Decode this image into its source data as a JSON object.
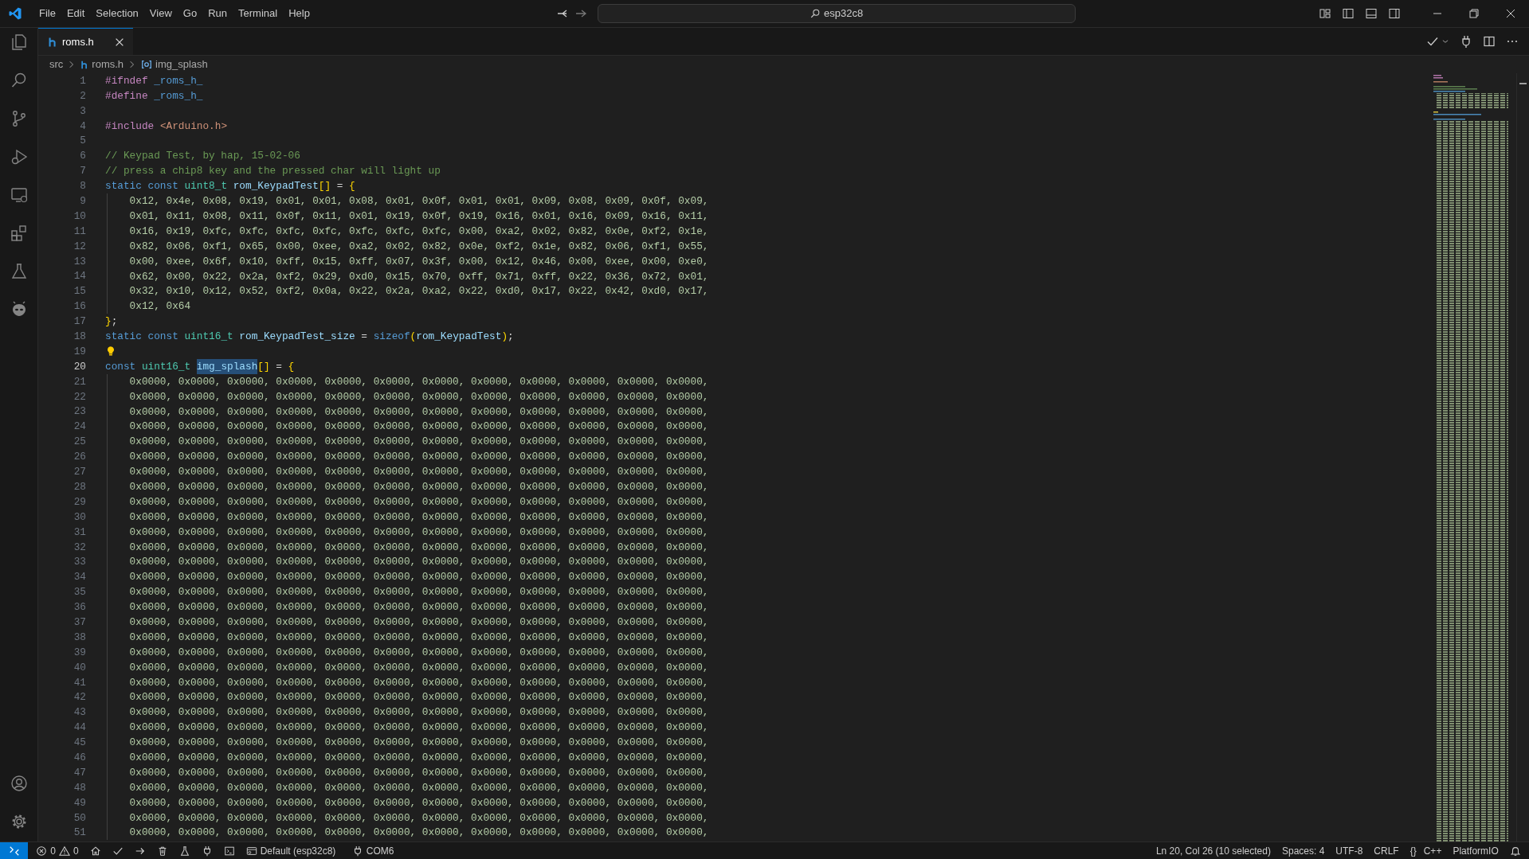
{
  "title_bar": {
    "menu": [
      "File",
      "Edit",
      "Selection",
      "View",
      "Go",
      "Run",
      "Terminal",
      "Help"
    ],
    "search": {
      "value": "esp32c8"
    }
  },
  "tabs": [
    {
      "label": "roms.h",
      "selected": true
    }
  ],
  "breadcrumb": {
    "folder": "src",
    "file": "roms.h",
    "symbol": "img_splash"
  },
  "editor": {
    "lines": [
      {
        "number": "1",
        "current": false,
        "guide": false,
        "tokens": [
          {
            "kind": "pre",
            "text": "#ifndef "
          },
          {
            "kind": "macro",
            "text": "_roms_h_"
          }
        ]
      },
      {
        "number": "2",
        "current": false,
        "guide": false,
        "tokens": [
          {
            "kind": "pre",
            "text": "#define "
          },
          {
            "kind": "macro",
            "text": "_roms_h_"
          }
        ]
      },
      {
        "number": "3",
        "current": false,
        "guide": false
      },
      {
        "number": "4",
        "current": false,
        "guide": false,
        "tokens": [
          {
            "kind": "pre",
            "text": "#include "
          },
          {
            "kind": "str",
            "text": "<Arduino.h>"
          }
        ]
      },
      {
        "number": "5",
        "current": false,
        "guide": false
      },
      {
        "number": "6",
        "current": false,
        "guide": false,
        "tokens": [
          {
            "kind": "com",
            "text": "// Keypad Test, by hap, 15-02-06"
          }
        ]
      },
      {
        "number": "7",
        "current": false,
        "guide": false,
        "tokens": [
          {
            "kind": "com",
            "text": "// press a chip8 key and the pressed char will light up"
          }
        ]
      },
      {
        "number": "8",
        "current": false,
        "guide": false,
        "tokens": [
          {
            "kind": "kw",
            "text": "static const "
          },
          {
            "kind": "type",
            "text": "uint8_t "
          },
          {
            "kind": "var",
            "text": "rom_KeypadTest"
          },
          {
            "kind": "br",
            "text": "[]"
          },
          {
            "kind": "op",
            "text": " = "
          },
          {
            "kind": "br",
            "text": "{"
          }
        ]
      },
      {
        "number": "9",
        "current": false,
        "guide": true,
        "tokens": [
          {
            "kind": "num",
            "text": "    0x12, 0x4e, 0x08, 0x19, 0x01, 0x01, 0x08, 0x01, 0x0f, 0x01, 0x01, 0x09, 0x08, 0x09, 0x0f, 0x09,"
          }
        ]
      },
      {
        "number": "10",
        "current": false,
        "guide": true,
        "tokens": [
          {
            "kind": "num",
            "text": "    0x01, 0x11, 0x08, 0x11, 0x0f, 0x11, 0x01, 0x19, 0x0f, 0x19, 0x16, 0x01, 0x16, 0x09, 0x16, 0x11,"
          }
        ]
      },
      {
        "number": "11",
        "current": false,
        "guide": true,
        "tokens": [
          {
            "kind": "num",
            "text": "    0x16, 0x19, 0xfc, 0xfc, 0xfc, 0xfc, 0xfc, 0xfc, 0xfc, 0x00, 0xa2, 0x02, 0x82, 0x0e, 0xf2, 0x1e,"
          }
        ]
      },
      {
        "number": "12",
        "current": false,
        "guide": true,
        "tokens": [
          {
            "kind": "num",
            "text": "    0x82, 0x06, 0xf1, 0x65, 0x00, 0xee, 0xa2, 0x02, 0x82, 0x0e, 0xf2, 0x1e, 0x82, 0x06, 0xf1, 0x55,"
          }
        ]
      },
      {
        "number": "13",
        "current": false,
        "guide": true,
        "tokens": [
          {
            "kind": "num",
            "text": "    0x00, 0xee, 0x6f, 0x10, 0xff, 0x15, 0xff, 0x07, 0x3f, 0x00, 0x12, 0x46, 0x00, 0xee, 0x00, 0xe0,"
          }
        ]
      },
      {
        "number": "14",
        "current": false,
        "guide": true,
        "tokens": [
          {
            "kind": "num",
            "text": "    0x62, 0x00, 0x22, 0x2a, 0xf2, 0x29, 0xd0, 0x15, 0x70, 0xff, 0x71, 0xff, 0x22, 0x36, 0x72, 0x01,"
          }
        ]
      },
      {
        "number": "15",
        "current": false,
        "guide": true,
        "tokens": [
          {
            "kind": "num",
            "text": "    0x32, 0x10, 0x12, 0x52, 0xf2, 0x0a, 0x22, 0x2a, 0xa2, 0x22, 0xd0, 0x17, 0x22, 0x42, 0xd0, 0x17,"
          }
        ]
      },
      {
        "number": "16",
        "current": false,
        "guide": true,
        "tokens": [
          {
            "kind": "num",
            "text": "    0x12, 0x64"
          }
        ]
      },
      {
        "number": "17",
        "current": false,
        "guide": false,
        "tokens": [
          {
            "kind": "br",
            "text": "}"
          },
          {
            "kind": "op",
            "text": ";"
          }
        ]
      },
      {
        "number": "18",
        "current": false,
        "guide": false,
        "tokens": [
          {
            "kind": "kw",
            "text": "static const "
          },
          {
            "kind": "type",
            "text": "uint16_t "
          },
          {
            "kind": "var",
            "text": "rom_KeypadTest_size"
          },
          {
            "kind": "op",
            "text": " = "
          },
          {
            "kind": "kw",
            "text": "sizeof"
          },
          {
            "kind": "br",
            "text": "("
          },
          {
            "kind": "var",
            "text": "rom_KeypadTest"
          },
          {
            "kind": "br",
            "text": ")"
          },
          {
            "kind": "op",
            "text": ";"
          }
        ]
      },
      {
        "number": "19",
        "current": false,
        "guide": false,
        "tokens": [
          {
            "kind": "bulb"
          }
        ]
      },
      {
        "number": "20",
        "current": true,
        "guide": false,
        "tokens": [
          {
            "kind": "kw",
            "text": "const "
          },
          {
            "kind": "type",
            "text": "uint16_t "
          },
          {
            "kind": "sel",
            "text": "img_splash"
          },
          {
            "kind": "br",
            "text": "[]"
          },
          {
            "kind": "op",
            "text": " = "
          },
          {
            "kind": "br",
            "text": "{"
          }
        ]
      },
      {
        "number": "21",
        "current": false,
        "guide": true,
        "tokens": [
          {
            "kind": "num",
            "text": "    0x0000, 0x0000, 0x0000, 0x0000, 0x0000, 0x0000, 0x0000, 0x0000, 0x0000, 0x0000, 0x0000, 0x0000,"
          }
        ]
      },
      {
        "number": "22",
        "current": false,
        "guide": true,
        "tokens": [
          {
            "kind": "num",
            "text": "    0x0000, 0x0000, 0x0000, 0x0000, 0x0000, 0x0000, 0x0000, 0x0000, 0x0000, 0x0000, 0x0000, 0x0000,"
          }
        ]
      },
      {
        "number": "23",
        "current": false,
        "guide": true,
        "tokens": [
          {
            "kind": "num",
            "text": "    0x0000, 0x0000, 0x0000, 0x0000, 0x0000, 0x0000, 0x0000, 0x0000, 0x0000, 0x0000, 0x0000, 0x0000,"
          }
        ]
      },
      {
        "number": "24",
        "current": false,
        "guide": true,
        "tokens": [
          {
            "kind": "num",
            "text": "    0x0000, 0x0000, 0x0000, 0x0000, 0x0000, 0x0000, 0x0000, 0x0000, 0x0000, 0x0000, 0x0000, 0x0000,"
          }
        ]
      },
      {
        "number": "25",
        "current": false,
        "guide": true,
        "tokens": [
          {
            "kind": "num",
            "text": "    0x0000, 0x0000, 0x0000, 0x0000, 0x0000, 0x0000, 0x0000, 0x0000, 0x0000, 0x0000, 0x0000, 0x0000,"
          }
        ]
      },
      {
        "number": "26",
        "current": false,
        "guide": true,
        "tokens": [
          {
            "kind": "num",
            "text": "    0x0000, 0x0000, 0x0000, 0x0000, 0x0000, 0x0000, 0x0000, 0x0000, 0x0000, 0x0000, 0x0000, 0x0000,"
          }
        ]
      },
      {
        "number": "27",
        "current": false,
        "guide": true,
        "tokens": [
          {
            "kind": "num",
            "text": "    0x0000, 0x0000, 0x0000, 0x0000, 0x0000, 0x0000, 0x0000, 0x0000, 0x0000, 0x0000, 0x0000, 0x0000,"
          }
        ]
      },
      {
        "number": "28",
        "current": false,
        "guide": true,
        "tokens": [
          {
            "kind": "num",
            "text": "    0x0000, 0x0000, 0x0000, 0x0000, 0x0000, 0x0000, 0x0000, 0x0000, 0x0000, 0x0000, 0x0000, 0x0000,"
          }
        ]
      },
      {
        "number": "29",
        "current": false,
        "guide": true,
        "tokens": [
          {
            "kind": "num",
            "text": "    0x0000, 0x0000, 0x0000, 0x0000, 0x0000, 0x0000, 0x0000, 0x0000, 0x0000, 0x0000, 0x0000, 0x0000,"
          }
        ]
      },
      {
        "number": "30",
        "current": false,
        "guide": true,
        "tokens": [
          {
            "kind": "num",
            "text": "    0x0000, 0x0000, 0x0000, 0x0000, 0x0000, 0x0000, 0x0000, 0x0000, 0x0000, 0x0000, 0x0000, 0x0000,"
          }
        ]
      },
      {
        "number": "31",
        "current": false,
        "guide": true,
        "tokens": [
          {
            "kind": "num",
            "text": "    0x0000, 0x0000, 0x0000, 0x0000, 0x0000, 0x0000, 0x0000, 0x0000, 0x0000, 0x0000, 0x0000, 0x0000,"
          }
        ]
      },
      {
        "number": "32",
        "current": false,
        "guide": true,
        "tokens": [
          {
            "kind": "num",
            "text": "    0x0000, 0x0000, 0x0000, 0x0000, 0x0000, 0x0000, 0x0000, 0x0000, 0x0000, 0x0000, 0x0000, 0x0000,"
          }
        ]
      },
      {
        "number": "33",
        "current": false,
        "guide": true,
        "tokens": [
          {
            "kind": "num",
            "text": "    0x0000, 0x0000, 0x0000, 0x0000, 0x0000, 0x0000, 0x0000, 0x0000, 0x0000, 0x0000, 0x0000, 0x0000,"
          }
        ]
      },
      {
        "number": "34",
        "current": false,
        "guide": true,
        "tokens": [
          {
            "kind": "num",
            "text": "    0x0000, 0x0000, 0x0000, 0x0000, 0x0000, 0x0000, 0x0000, 0x0000, 0x0000, 0x0000, 0x0000, 0x0000,"
          }
        ]
      },
      {
        "number": "35",
        "current": false,
        "guide": true,
        "tokens": [
          {
            "kind": "num",
            "text": "    0x0000, 0x0000, 0x0000, 0x0000, 0x0000, 0x0000, 0x0000, 0x0000, 0x0000, 0x0000, 0x0000, 0x0000,"
          }
        ]
      },
      {
        "number": "36",
        "current": false,
        "guide": true,
        "tokens": [
          {
            "kind": "num",
            "text": "    0x0000, 0x0000, 0x0000, 0x0000, 0x0000, 0x0000, 0x0000, 0x0000, 0x0000, 0x0000, 0x0000, 0x0000,"
          }
        ]
      },
      {
        "number": "37",
        "current": false,
        "guide": true,
        "tokens": [
          {
            "kind": "num",
            "text": "    0x0000, 0x0000, 0x0000, 0x0000, 0x0000, 0x0000, 0x0000, 0x0000, 0x0000, 0x0000, 0x0000, 0x0000,"
          }
        ]
      },
      {
        "number": "38",
        "current": false,
        "guide": true,
        "tokens": [
          {
            "kind": "num",
            "text": "    0x0000, 0x0000, 0x0000, 0x0000, 0x0000, 0x0000, 0x0000, 0x0000, 0x0000, 0x0000, 0x0000, 0x0000,"
          }
        ]
      },
      {
        "number": "39",
        "current": false,
        "guide": true,
        "tokens": [
          {
            "kind": "num",
            "text": "    0x0000, 0x0000, 0x0000, 0x0000, 0x0000, 0x0000, 0x0000, 0x0000, 0x0000, 0x0000, 0x0000, 0x0000,"
          }
        ]
      },
      {
        "number": "40",
        "current": false,
        "guide": true,
        "tokens": [
          {
            "kind": "num",
            "text": "    0x0000, 0x0000, 0x0000, 0x0000, 0x0000, 0x0000, 0x0000, 0x0000, 0x0000, 0x0000, 0x0000, 0x0000,"
          }
        ]
      },
      {
        "number": "41",
        "current": false,
        "guide": true,
        "tokens": [
          {
            "kind": "num",
            "text": "    0x0000, 0x0000, 0x0000, 0x0000, 0x0000, 0x0000, 0x0000, 0x0000, 0x0000, 0x0000, 0x0000, 0x0000,"
          }
        ]
      },
      {
        "number": "42",
        "current": false,
        "guide": true,
        "tokens": [
          {
            "kind": "num",
            "text": "    0x0000, 0x0000, 0x0000, 0x0000, 0x0000, 0x0000, 0x0000, 0x0000, 0x0000, 0x0000, 0x0000, 0x0000,"
          }
        ]
      },
      {
        "number": "43",
        "current": false,
        "guide": true,
        "tokens": [
          {
            "kind": "num",
            "text": "    0x0000, 0x0000, 0x0000, 0x0000, 0x0000, 0x0000, 0x0000, 0x0000, 0x0000, 0x0000, 0x0000, 0x0000,"
          }
        ]
      },
      {
        "number": "44",
        "current": false,
        "guide": true,
        "tokens": [
          {
            "kind": "num",
            "text": "    0x0000, 0x0000, 0x0000, 0x0000, 0x0000, 0x0000, 0x0000, 0x0000, 0x0000, 0x0000, 0x0000, 0x0000,"
          }
        ]
      },
      {
        "number": "45",
        "current": false,
        "guide": true,
        "tokens": [
          {
            "kind": "num",
            "text": "    0x0000, 0x0000, 0x0000, 0x0000, 0x0000, 0x0000, 0x0000, 0x0000, 0x0000, 0x0000, 0x0000, 0x0000,"
          }
        ]
      },
      {
        "number": "46",
        "current": false,
        "guide": true,
        "tokens": [
          {
            "kind": "num",
            "text": "    0x0000, 0x0000, 0x0000, 0x0000, 0x0000, 0x0000, 0x0000, 0x0000, 0x0000, 0x0000, 0x0000, 0x0000,"
          }
        ]
      },
      {
        "number": "47",
        "current": false,
        "guide": true,
        "tokens": [
          {
            "kind": "num",
            "text": "    0x0000, 0x0000, 0x0000, 0x0000, 0x0000, 0x0000, 0x0000, 0x0000, 0x0000, 0x0000, 0x0000, 0x0000,"
          }
        ]
      },
      {
        "number": "48",
        "current": false,
        "guide": true,
        "tokens": [
          {
            "kind": "num",
            "text": "    0x0000, 0x0000, 0x0000, 0x0000, 0x0000, 0x0000, 0x0000, 0x0000, 0x0000, 0x0000, 0x0000, 0x0000,"
          }
        ]
      },
      {
        "number": "49",
        "current": false,
        "guide": true,
        "tokens": [
          {
            "kind": "num",
            "text": "    0x0000, 0x0000, 0x0000, 0x0000, 0x0000, 0x0000, 0x0000, 0x0000, 0x0000, 0x0000, 0x0000, 0x0000,"
          }
        ]
      },
      {
        "number": "50",
        "current": false,
        "guide": true,
        "tokens": [
          {
            "kind": "num",
            "text": "    0x0000, 0x0000, 0x0000, 0x0000, 0x0000, 0x0000, 0x0000, 0x0000, 0x0000, 0x0000, 0x0000, 0x0000,"
          }
        ]
      },
      {
        "number": "51",
        "current": false,
        "guide": true,
        "tokens": [
          {
            "kind": "num",
            "text": "    0x0000, 0x0000, 0x0000, 0x0000, 0x0000, 0x0000, 0x0000, 0x0000, 0x0000, 0x0000, 0x0000, 0x0000,"
          }
        ]
      }
    ]
  },
  "status_bar": {
    "errors": "0",
    "warnings": "0",
    "environment": "Default (esp32c8)",
    "port": "COM6",
    "right": [
      "Ln 20, Col 26 (10 selected)",
      "Spaces: 4",
      "UTF-8",
      "CRLF",
      "{}",
      "C++",
      "PlatformIO"
    ]
  }
}
